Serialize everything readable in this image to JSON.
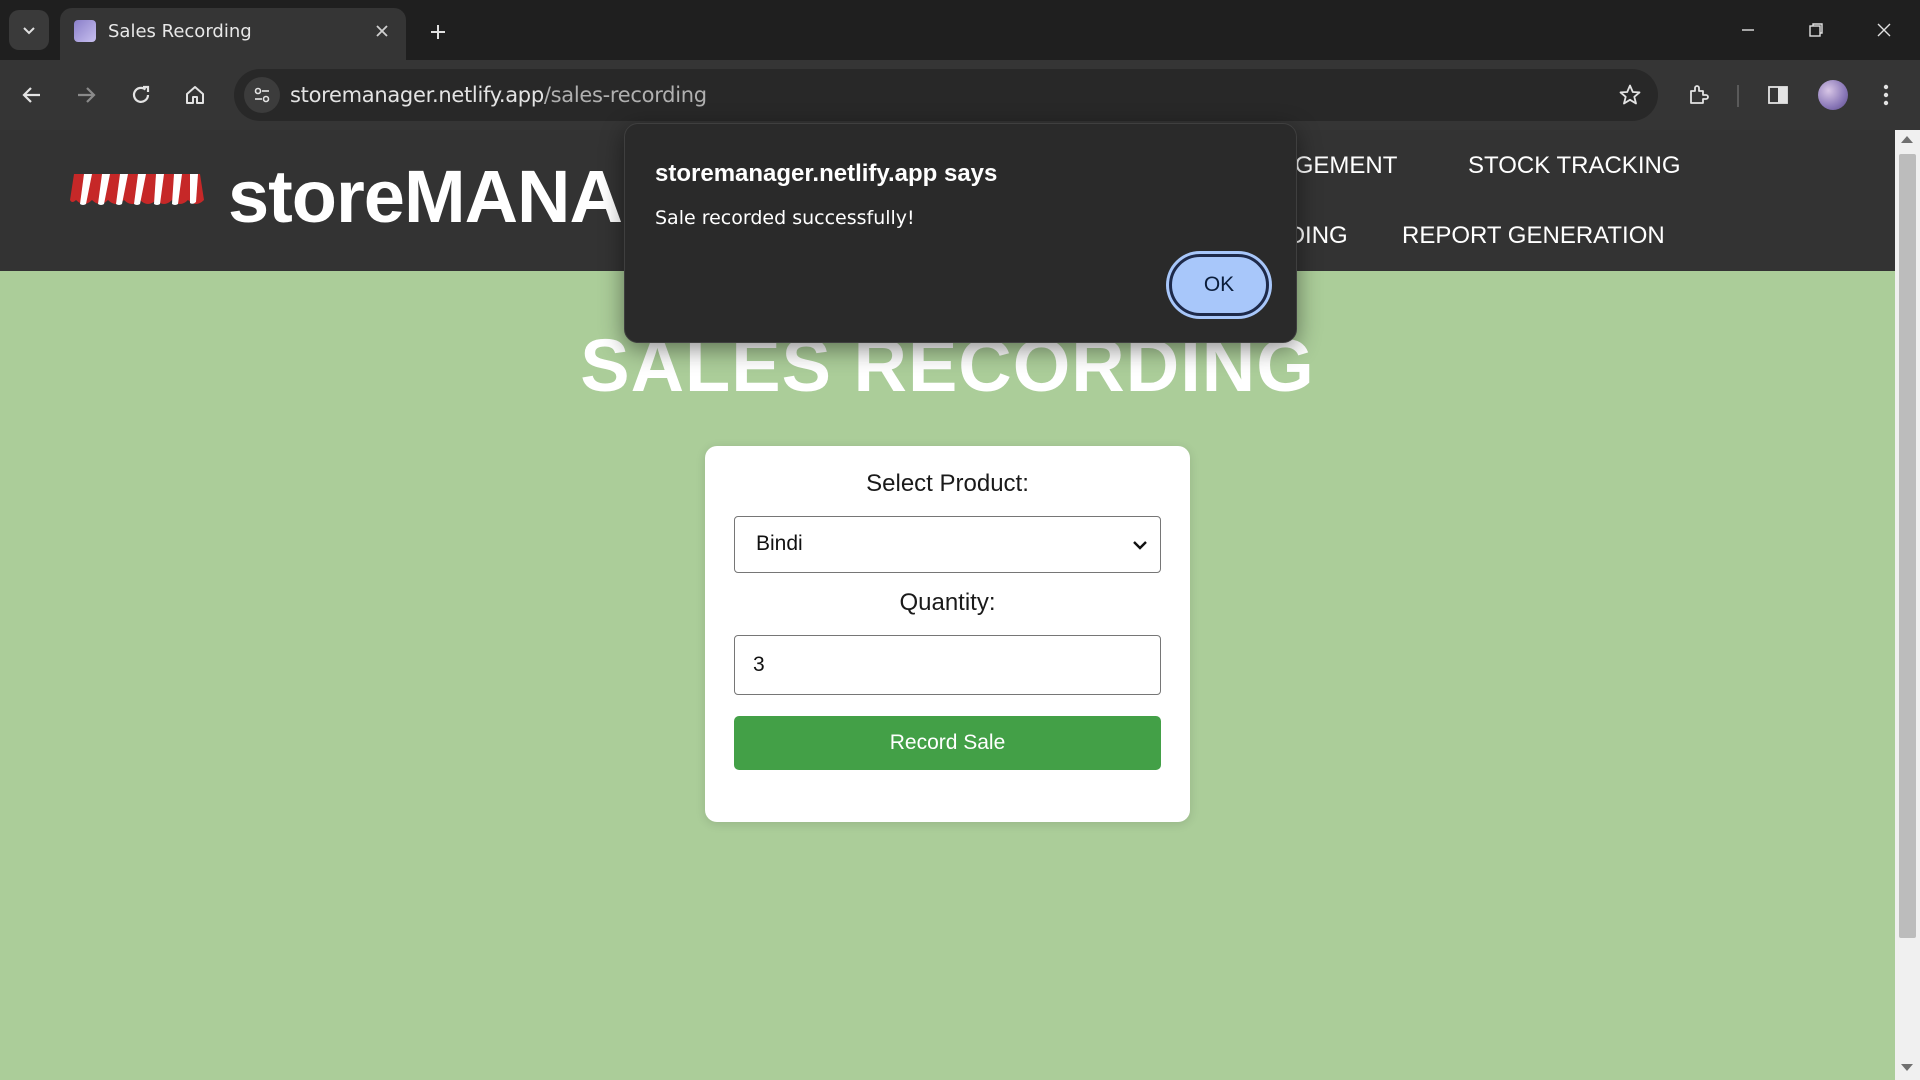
{
  "browser": {
    "tab_title": "Sales Recording",
    "url_host": "storemanager.netlify.app",
    "url_path": "/sales-recording"
  },
  "site": {
    "brand": "storeMANAGER",
    "nav": {
      "inventory": "INVENTORY MANAGEMENT",
      "stock": "STOCK TRACKING",
      "sales": "SALES RECORDING",
      "reports": "REPORT GENERATION"
    }
  },
  "page": {
    "title": "SALES RECORDING"
  },
  "form": {
    "product_label": "Select Product:",
    "product_value": "Bindi",
    "quantity_label": "Quantity:",
    "quantity_value": "3",
    "submit_label": "Record Sale"
  },
  "dialog": {
    "title": "storemanager.netlify.app says",
    "message": "Sale recorded successfully!",
    "ok_label": "OK"
  },
  "colors": {
    "page_bg": "#abcd99",
    "header_bg": "#333333",
    "button_green": "#43a047",
    "dialog_bg": "#2a2a2a",
    "ok_button": "#a8c7fa"
  },
  "icons": [
    "tab-search-icon",
    "close-icon",
    "plus-icon",
    "minimize-icon",
    "restore-icon",
    "back-icon",
    "forward-icon",
    "reload-icon",
    "home-icon",
    "site-info-icon",
    "star-icon",
    "extensions-icon",
    "side-panel-icon",
    "more-icon",
    "chevron-down-icon"
  ]
}
